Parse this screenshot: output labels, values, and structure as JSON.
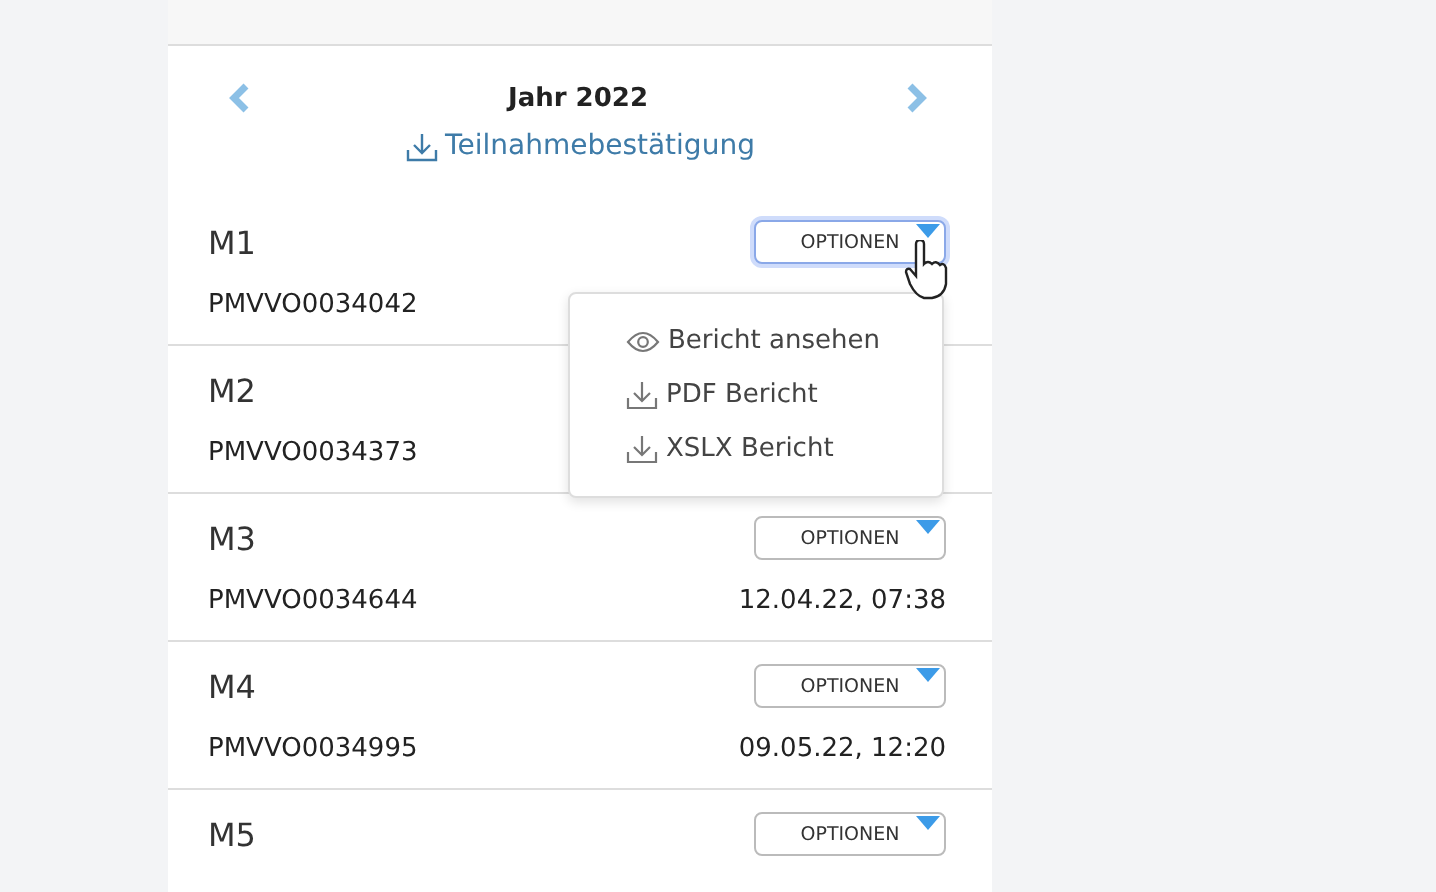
{
  "year_nav": {
    "title": "Jahr 2022",
    "download_link": "Teilnahmebestätigung"
  },
  "rows": [
    {
      "name": "M1",
      "options": "OPTIONEN",
      "focused": true,
      "id": "PMVVO0034042"
    },
    {
      "name": "M2",
      "id": "PMVVO0034373"
    },
    {
      "name": "M3",
      "options": "OPTIONEN",
      "focused": false,
      "id": "PMVVO0034644",
      "date": "12.04.22, 07:38"
    },
    {
      "name": "M4",
      "options": "OPTIONEN",
      "focused": false,
      "id": "PMVVO0034995",
      "date": "09.05.22, 12:20"
    },
    {
      "name": "M5",
      "options": "OPTIONEN",
      "focused": false
    }
  ],
  "dropdown": {
    "items": [
      {
        "kind": "view",
        "label": "Bericht ansehen"
      },
      {
        "kind": "download",
        "label": "PDF Bericht"
      },
      {
        "kind": "download",
        "label": "XSLX Bericht"
      }
    ]
  }
}
